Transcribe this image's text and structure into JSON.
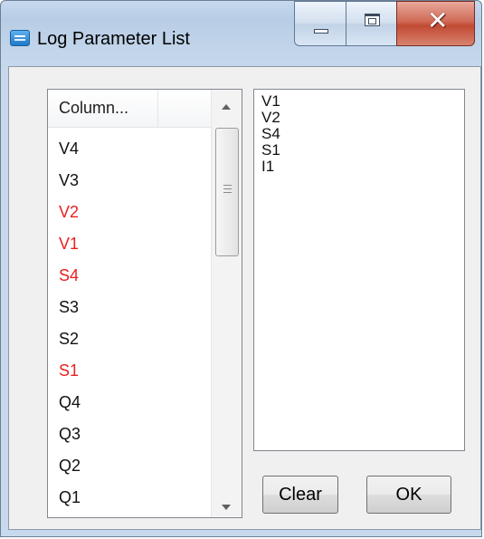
{
  "window": {
    "title": "Log Parameter List",
    "icon": "list-app-icon",
    "caption_buttons": [
      "minimize",
      "maximize",
      "close"
    ],
    "close_color": "#c24a33"
  },
  "parameter_list": {
    "column_header": "Column...",
    "items": [
      {
        "label": "V4",
        "selected": false
      },
      {
        "label": "V3",
        "selected": false
      },
      {
        "label": "V2",
        "selected": true
      },
      {
        "label": "V1",
        "selected": true
      },
      {
        "label": "S4",
        "selected": true
      },
      {
        "label": "S3",
        "selected": false
      },
      {
        "label": "S2",
        "selected": false
      },
      {
        "label": "S1",
        "selected": true
      },
      {
        "label": "Q4",
        "selected": false
      },
      {
        "label": "Q3",
        "selected": false
      },
      {
        "label": "Q2",
        "selected": false
      },
      {
        "label": "Q1",
        "selected": false
      }
    ],
    "selected_color": "#e82020"
  },
  "selected_list": {
    "lines": [
      "V1",
      "V2",
      "S4",
      "S1",
      "I1"
    ]
  },
  "buttons": {
    "clear_label": "Clear",
    "ok_label": "OK"
  }
}
